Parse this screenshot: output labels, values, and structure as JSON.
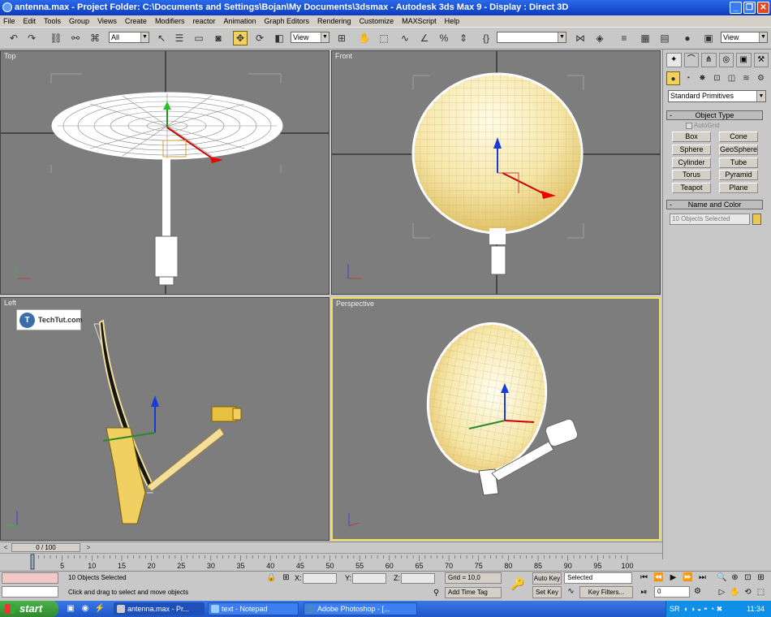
{
  "window": {
    "title": "antenna.max    - Project Folder: C:\\Documents and Settings\\Bojan\\My Documents\\3dsmax    - Autodesk 3ds Max 9     - Display : Direct 3D",
    "min": "_",
    "max": "❐",
    "close": "✕"
  },
  "menu": [
    "File",
    "Edit",
    "Tools",
    "Group",
    "Views",
    "Create",
    "Modifiers",
    "reactor",
    "Animation",
    "Graph Editors",
    "Rendering",
    "Customize",
    "MAXScript",
    "Help"
  ],
  "toolbar": {
    "selection_filter": "All",
    "ref_coord": "View",
    "named_sel": "",
    "ref_coord2": "View"
  },
  "viewports": {
    "top": "Top",
    "front": "Front",
    "left": "Left",
    "perspective": "Perspective"
  },
  "logo": {
    "text": "TechTut.com",
    "mark": "T"
  },
  "command_panel": {
    "category": "Standard Primitives",
    "object_type_header": "Object Type",
    "autogrid": "AutoGrid",
    "buttons": [
      "Box",
      "Cone",
      "Sphere",
      "GeoSphere",
      "Cylinder",
      "Tube",
      "Torus",
      "Pyramid",
      "Teapot",
      "Plane"
    ],
    "name_color_header": "Name and Color",
    "name_value": "10 Objects Selected"
  },
  "timeline": {
    "slider": "0 / 100",
    "ticks": [
      "0",
      "5",
      "10",
      "15",
      "20",
      "25",
      "30",
      "35",
      "40",
      "45",
      "50",
      "55",
      "60",
      "65",
      "70",
      "75",
      "80",
      "85",
      "90",
      "95",
      "100"
    ]
  },
  "status": {
    "selection": "10 Objects Selected",
    "prompt": "Click and drag to select and move objects",
    "x_label": "X:",
    "y_label": "Y:",
    "z_label": "Z:",
    "grid": "Grid = 10,0",
    "add_time_tag": "Add Time Tag",
    "auto_key": "Auto Key",
    "set_key": "Set Key",
    "key_mode": "Selected",
    "key_filters": "Key Filters...",
    "frame": "0"
  },
  "taskbar": {
    "start": "start",
    "items": [
      "antenna.max - Pr...",
      "text - Notepad",
      "Adobe Photoshop - [..."
    ],
    "lang": "SR",
    "clock": "11:34"
  },
  "colors": {
    "active_tool": "#f0d060",
    "viewport_bg": "#7d7d7d",
    "dish_yellow": "#f3df9a"
  }
}
